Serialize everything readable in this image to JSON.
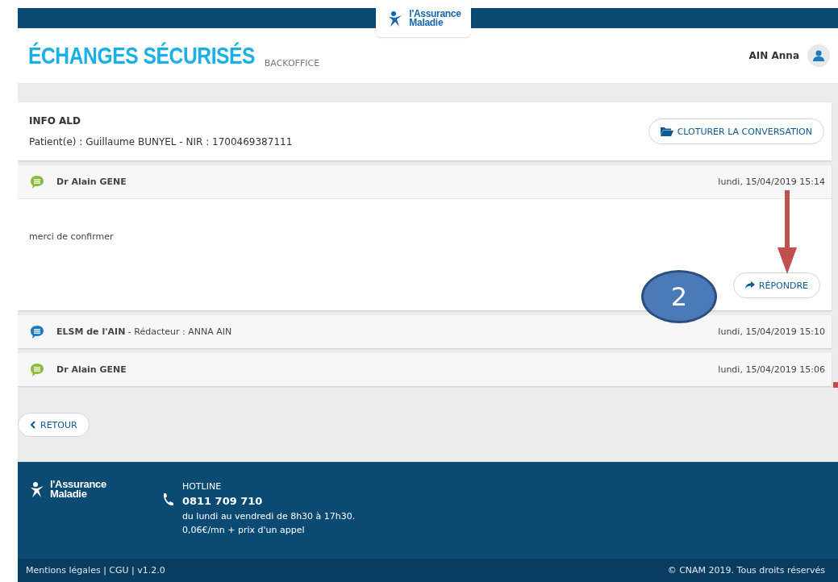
{
  "header": {
    "logo": [
      "l'Assurance",
      "Maladie"
    ],
    "title": "ÉCHANGES SÉCURISÉS",
    "subtitle": "BACKOFFICE",
    "user": "AIN Anna"
  },
  "conversation": {
    "subject": "INFO ALD",
    "patient": "Patient(e) : Guillaume BUNYEL - NIR : 1700469387111",
    "close_button": "CLOTURER LA CONVERSATION"
  },
  "messages": [
    {
      "sender": "**Dr Alain GENE**",
      "date": "lundi, 15/04/2019 15:14",
      "color": "#8cba3c",
      "expanded": true,
      "body": "merci de confirmer",
      "reply_button": "RÉPONDRE"
    },
    {
      "sender": "**ELSM de l'AIN** - Rédacteur : ANNA AIN",
      "date": "lundi, 15/04/2019 15:10",
      "color": "#1a7bc0",
      "expanded": false
    },
    {
      "sender": "**Dr Alain GENE**",
      "date": "lundi, 15/04/2019 15:06",
      "color": "#8cba3c",
      "expanded": false
    }
  ],
  "back_button": "RETOUR",
  "annotation": {
    "badge": "2"
  },
  "footer": {
    "logo": [
      "l'Assurance",
      "Maladie"
    ],
    "hotline_label": "HOTLINE",
    "phone": "0811 709 710",
    "hours": "du lundi au vendredi de 8h30 à 17h30.",
    "price": "0,06€/mn + prix d'un appel",
    "links": "Mentions légales | CGU | v1.2.0",
    "copyright": "© CNAM 2019. Tous droits réservés"
  }
}
